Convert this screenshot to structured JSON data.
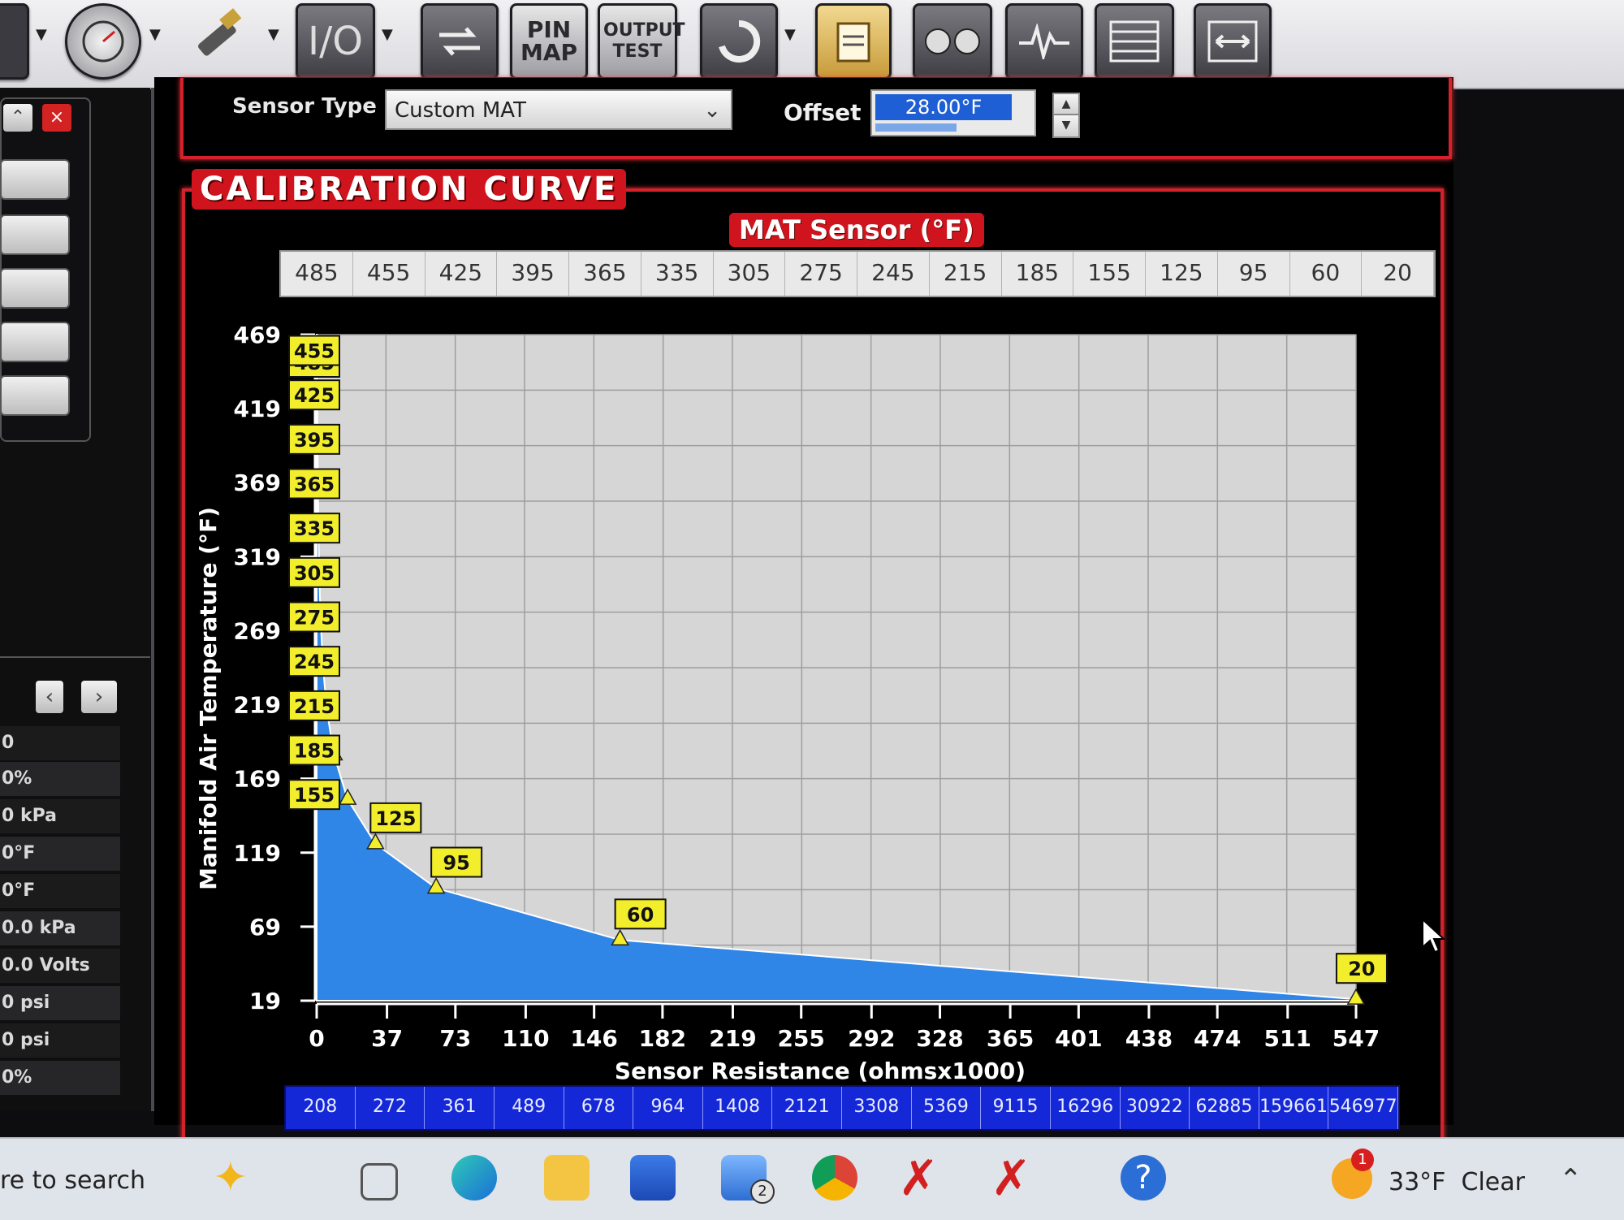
{
  "toolbar": {
    "buttons": [
      {
        "name": "gauge",
        "label": ""
      },
      {
        "name": "spark-plug",
        "label": ""
      },
      {
        "name": "io",
        "label": "I/O"
      },
      {
        "name": "swap",
        "label": ""
      },
      {
        "name": "pin-map",
        "label": "PIN MAP"
      },
      {
        "name": "output-test",
        "label": "OUTPUT TEST"
      },
      {
        "name": "refresh",
        "label": ""
      },
      {
        "name": "clipboard",
        "label": ""
      },
      {
        "name": "dual-gauge",
        "label": ""
      },
      {
        "name": "pulse",
        "label": ""
      },
      {
        "name": "table",
        "label": ""
      },
      {
        "name": "expand",
        "label": ""
      }
    ]
  },
  "sensor": {
    "label": "Sensor Type",
    "value": "Custom MAT",
    "offset_label": "Offset",
    "offset_value": "28.00°F"
  },
  "left_panel": {
    "readouts": [
      "0",
      "0%",
      "0 kPa",
      "0°F",
      "0°F",
      "0.0 kPa",
      "0.0 Volts",
      "0 psi",
      "0 psi",
      "0%"
    ]
  },
  "calibration": {
    "title": "CALIBRATION CURVE"
  },
  "chart_data": {
    "type": "area",
    "series_name": "MAT Sensor (°F)",
    "xlabel": "Sensor Resistance (ohmsx1000)",
    "ylabel": "Manifold Air Temperature (°F)",
    "x_ticks": [
      "0",
      "37",
      "73",
      "110",
      "146",
      "182",
      "219",
      "255",
      "292",
      "328",
      "365",
      "401",
      "438",
      "474",
      "511",
      "547"
    ],
    "y_ticks": [
      "19",
      "69",
      "119",
      "169",
      "219",
      "269",
      "319",
      "369",
      "419",
      "469"
    ],
    "xlim": [
      0,
      547
    ],
    "ylim": [
      19,
      469
    ],
    "temperatures": [
      485,
      455,
      425,
      395,
      365,
      335,
      305,
      275,
      245,
      215,
      185,
      155,
      125,
      95,
      60,
      20
    ],
    "resistances": [
      208,
      272,
      361,
      489,
      678,
      964,
      1408,
      2121,
      3308,
      5369,
      9115,
      16296,
      30922,
      62885,
      159661,
      546977
    ],
    "points": [
      {
        "x": 0.208,
        "y": 485
      },
      {
        "x": 0.272,
        "y": 455
      },
      {
        "x": 0.361,
        "y": 425
      },
      {
        "x": 0.489,
        "y": 395
      },
      {
        "x": 0.678,
        "y": 365
      },
      {
        "x": 0.964,
        "y": 335
      },
      {
        "x": 1.408,
        "y": 305
      },
      {
        "x": 2.121,
        "y": 275
      },
      {
        "x": 3.308,
        "y": 245
      },
      {
        "x": 5.369,
        "y": 215
      },
      {
        "x": 9.115,
        "y": 185
      },
      {
        "x": 16.296,
        "y": 155
      },
      {
        "x": 30.922,
        "y": 125
      },
      {
        "x": 62.885,
        "y": 95
      },
      {
        "x": 159.661,
        "y": 60
      },
      {
        "x": 546.977,
        "y": 20
      }
    ],
    "grid": true,
    "fill_color": "#2f86e6",
    "marker_color": "#f3ee2c"
  },
  "taskbar": {
    "search_text": "re to search",
    "weather": "33°F  Clear",
    "mail_badge": "2",
    "notification_badge": "1"
  },
  "colors": {
    "frame_red": "#d4212b",
    "resistance_row": "#1528d8",
    "plot_bg": "#d6d6d6"
  }
}
